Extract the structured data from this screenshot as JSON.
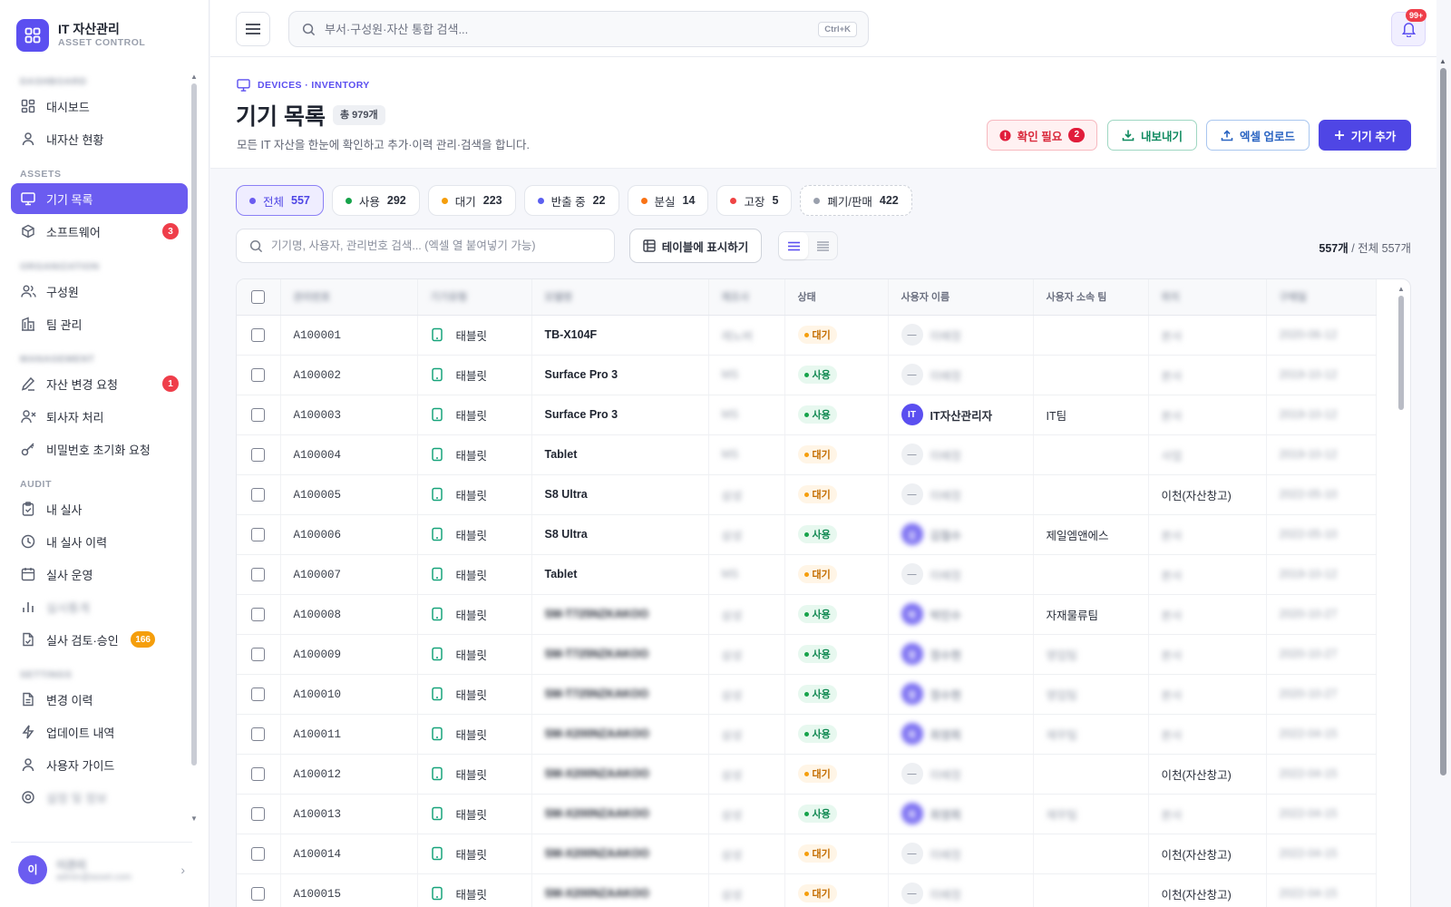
{
  "app": {
    "title": "IT 자산관리",
    "subtitle": "ASSET CONTROL"
  },
  "sidebar": {
    "sections": [
      {
        "label": "DASHBOARD",
        "blurred": true,
        "items": [
          {
            "label": "대시보드",
            "icon": "grid-icon"
          },
          {
            "label": "내자산 현황",
            "icon": "person-icon"
          }
        ]
      },
      {
        "label": "ASSETS",
        "items": [
          {
            "label": "기기 목록",
            "icon": "monitor-icon",
            "active": true
          },
          {
            "label": "소프트웨어",
            "icon": "cube-icon",
            "badge": "3"
          }
        ]
      },
      {
        "label": "ORGANIZATION",
        "blurred": true,
        "items": [
          {
            "label": "구성원",
            "icon": "users-icon"
          },
          {
            "label": "팀 관리",
            "icon": "building-icon"
          }
        ]
      },
      {
        "label": "MANAGEMENT",
        "blurred": true,
        "items": [
          {
            "label": "자산 변경 요청",
            "icon": "pen-icon",
            "badge": "1"
          },
          {
            "label": "퇴사자 처리",
            "icon": "user-x-icon"
          },
          {
            "label": "비밀번호 초기화 요청",
            "icon": "key-icon"
          }
        ]
      },
      {
        "label": "AUDIT",
        "items": [
          {
            "label": "내 실사",
            "icon": "clipboard-check-icon"
          },
          {
            "label": "내 실사 이력",
            "icon": "clock-icon"
          },
          {
            "label": "실사 운영",
            "icon": "calendar-icon"
          },
          {
            "label": "실사통계",
            "icon": "bar-chart-icon",
            "blurred": true
          },
          {
            "label": "실사 검토·승인",
            "icon": "file-check-icon",
            "badge": "166",
            "badge_color": "orange"
          }
        ]
      },
      {
        "label": "SETTINGS",
        "blurred": true,
        "items": [
          {
            "label": "변경 이력",
            "icon": "file-text-icon"
          },
          {
            "label": "업데이트 내역",
            "icon": "bolt-icon"
          },
          {
            "label": "사용자 가이드",
            "icon": "person-icon"
          },
          {
            "label": "설정 및 정보",
            "icon": "gear-icon",
            "blurred": true
          }
        ]
      }
    ]
  },
  "user": {
    "initial": "이",
    "name": "이관리",
    "email": "admin@asset.com"
  },
  "topbar": {
    "search_placeholder": "부서·구성원·자산 통합 검색...",
    "shortcut": "Ctrl+K",
    "notification_count": "99+"
  },
  "header": {
    "eyebrow": "DEVICES · INVENTORY",
    "title": "기기 목록",
    "total": "총 979개",
    "description": "모든 IT 자산을 한눈에 확인하고 추가·이력 관리·검색을 합니다.",
    "check_label": "확인 필요",
    "check_count": "2",
    "export_label": "내보내기",
    "upload_label": "엑셀 업로드",
    "add_label": "기기 추가"
  },
  "filters": [
    {
      "label": "전체",
      "count": "557",
      "color": "#6b5cf0",
      "active": true
    },
    {
      "label": "사용",
      "count": "292",
      "color": "#16a34a"
    },
    {
      "label": "대기",
      "count": "223",
      "color": "#f59e0b"
    },
    {
      "label": "반출 중",
      "count": "22",
      "color": "#5b5ff0"
    },
    {
      "label": "분실",
      "count": "14",
      "color": "#f97316"
    },
    {
      "label": "고장",
      "count": "5",
      "color": "#ef4444"
    },
    {
      "label": "폐기/판매",
      "count": "422",
      "color": "#9aa0ad",
      "dashed": true
    }
  ],
  "toolbar": {
    "search_placeholder": "기기명, 사용자, 관리번호 검색... (엑셀 열 붙여넣기 가능)",
    "show_table_label": "테이블에 표시하기",
    "result_shown": "557개",
    "result_total": " / 전체 557개"
  },
  "table": {
    "columns": [
      "관리번호",
      "기기유형",
      "모델명",
      "제조사",
      "상태",
      "사용자 이름",
      "사용자 소속 팀",
      "위치",
      "구매일"
    ],
    "rows": [
      {
        "id": "A100001",
        "type": "태블릿",
        "model": "TB-X104F",
        "maker": "레노버",
        "status": "대기",
        "user": "",
        "team": "",
        "location": "본사",
        "date": "2020-06-12"
      },
      {
        "id": "A100002",
        "type": "태블릿",
        "model": "Surface Pro 3",
        "maker": "MS",
        "status": "사용",
        "user": "",
        "team": "",
        "location": "본사",
        "date": "2019-10-12"
      },
      {
        "id": "A100003",
        "type": "태블릿",
        "model": "Surface Pro 3",
        "maker": "MS",
        "status": "사용",
        "user": "IT자산관리자",
        "user_initial": "IT",
        "team": "IT팀",
        "location": "본사",
        "date": "2019-10-12"
      },
      {
        "id": "A100004",
        "type": "태블릿",
        "model": "Tablet",
        "maker": "MS",
        "status": "대기",
        "user": "",
        "team": "",
        "location": "사업",
        "date": "2019-10-12"
      },
      {
        "id": "A100005",
        "type": "태블릿",
        "model": "S8 Ultra",
        "maker": "삼성",
        "status": "대기",
        "user": "",
        "team": "",
        "location": "이천(자산창고)",
        "date": "2022-05-10"
      },
      {
        "id": "A100006",
        "type": "태블릿",
        "model": "S8 Ultra",
        "maker": "삼성",
        "status": "사용",
        "user": "김철수",
        "user_initial": "김",
        "team": "제일엠앤에스",
        "location": "본사",
        "date": "2022-05-10"
      },
      {
        "id": "A100007",
        "type": "태블릿",
        "model": "Tablet",
        "maker": "MS",
        "status": "대기",
        "user": "",
        "team": "",
        "location": "본사",
        "date": "2019-10-12"
      },
      {
        "id": "A100008",
        "type": "태블릿",
        "model": "SM-T725NZKAKOO",
        "maker": "삼성",
        "status": "사용",
        "user": "박민수",
        "user_initial": "박",
        "team": "자재물류팀",
        "location": "본사",
        "date": "2020-10-27"
      },
      {
        "id": "A100009",
        "type": "태블릿",
        "model": "SM-T725NZKAKOO",
        "maker": "삼성",
        "status": "사용",
        "user": "정수현",
        "user_initial": "정",
        "team": "영업팀",
        "location": "본사",
        "date": "2020-10-27"
      },
      {
        "id": "A100010",
        "type": "태블릿",
        "model": "SM-T725NZKAKOO",
        "maker": "삼성",
        "status": "사용",
        "user": "정수현",
        "user_initial": "정",
        "team": "영업팀",
        "location": "본사",
        "date": "2020-10-27"
      },
      {
        "id": "A100011",
        "type": "태블릿",
        "model": "SM-X200NZAAKOO",
        "maker": "삼성",
        "status": "사용",
        "user": "최영희",
        "user_initial": "최",
        "team": "재무팀",
        "location": "본사",
        "date": "2022-04-15"
      },
      {
        "id": "A100012",
        "type": "태블릿",
        "model": "SM-X200NZAAKOO",
        "maker": "삼성",
        "status": "대기",
        "user": "",
        "team": "",
        "location": "이천(자산창고)",
        "date": "2022-04-15"
      },
      {
        "id": "A100013",
        "type": "태블릿",
        "model": "SM-X200NZAAKOO",
        "maker": "삼성",
        "status": "사용",
        "user": "최영희",
        "user_initial": "최",
        "team": "재무팀",
        "location": "본사",
        "date": "2022-04-15"
      },
      {
        "id": "A100014",
        "type": "태블릿",
        "model": "SM-X200NZAAKOO",
        "maker": "삼성",
        "status": "대기",
        "user": "",
        "team": "",
        "location": "이천(자산창고)",
        "date": "2022-04-15"
      },
      {
        "id": "A100015",
        "type": "태블릿",
        "model": "SM-X200NZAAKOO",
        "maker": "삼성",
        "status": "대기",
        "user": "",
        "team": "",
        "location": "이천(자산창고)",
        "date": "2022-04-15"
      }
    ]
  },
  "blurred_columns": [
    0,
    1,
    2,
    3,
    7,
    8
  ],
  "blurred_model_from_row": 7,
  "blurred_user_names": true,
  "blurred_teams": [
    "영업팀",
    "재무팀"
  ],
  "blurred_locations_except": [
    "이천(자산창고)"
  ],
  "colors": {
    "accent": "#5b4ff0",
    "active_nav": "#6b5cf0",
    "danger": "#ef3e4a",
    "warning": "#f59e0b",
    "success": "#16a34a"
  }
}
